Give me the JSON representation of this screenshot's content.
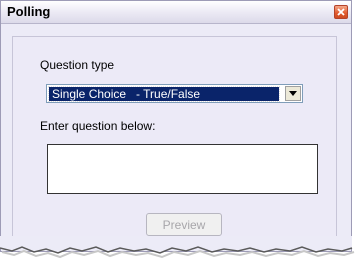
{
  "window": {
    "title": "Polling",
    "close_icon": "close-icon"
  },
  "question_type": {
    "label": "Question type",
    "selected": "Single Choice   - True/False"
  },
  "question": {
    "label": "Enter question below:",
    "value": ""
  },
  "actions": {
    "preview_label": "Preview"
  },
  "colors": {
    "window_bg": "#ecebf7",
    "selection_bg": "#0a246a",
    "close_button": "#e2592c"
  }
}
